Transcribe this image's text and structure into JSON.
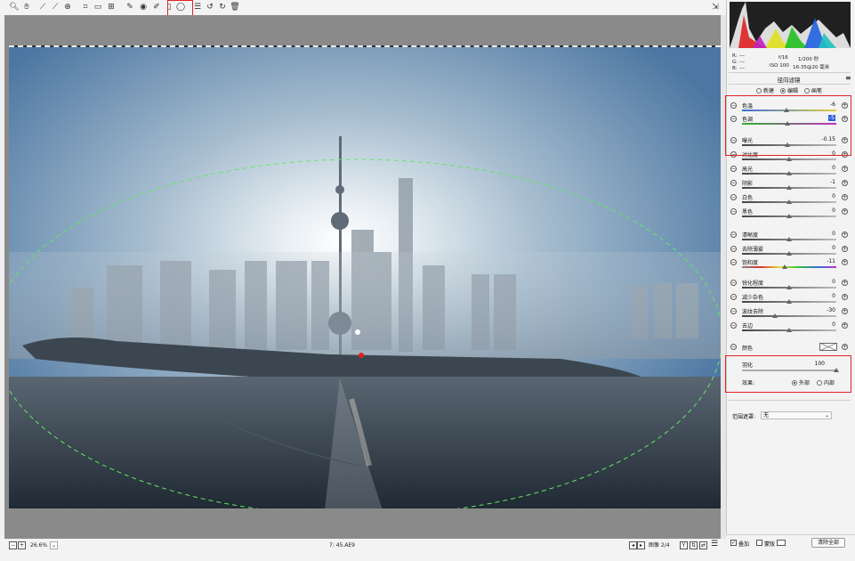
{
  "toolbar": {
    "icons": [
      "zoom-icon",
      "hand-icon",
      "white-balance-icon",
      "color-sampler-icon",
      "target-adjust-icon",
      "crop-icon",
      "straighten-icon",
      "transform-icon",
      "spot-removal-icon",
      "red-eye-icon",
      "adjustment-brush-icon",
      "graduated-filter-icon",
      "radial-filter-icon",
      "preferences-icon",
      "rotate-left-icon",
      "rotate-right-icon",
      "trash-icon"
    ],
    "fullscreen_icon": "fullscreen-icon"
  },
  "info": {
    "r_label": "R:",
    "g_label": "G:",
    "b_label": "B:",
    "r_val": "---",
    "g_val": "---",
    "b_val": "---",
    "aperture": "f/16",
    "shutter": "1/200 秒",
    "iso": "ISO 100",
    "lens": "16-35@20 毫米"
  },
  "panel": {
    "title": "径向滤镜",
    "modes": [
      {
        "label": "新建",
        "selected": false
      },
      {
        "label": "编辑",
        "selected": true
      },
      {
        "label": "画笔",
        "selected": false
      }
    ],
    "sliders": [
      {
        "label": "色温",
        "value": "-6",
        "pos": 0.47,
        "track": "temp"
      },
      {
        "label": "色调",
        "value": "-5",
        "pos": 0.48,
        "track": "tint",
        "selected": true
      },
      {
        "label": "曝光",
        "value": "-0.15",
        "pos": 0.48,
        "track": "plain"
      },
      {
        "label": "对比度",
        "value": "0",
        "pos": 0.5,
        "track": "plain"
      },
      {
        "label": "高光",
        "value": "0",
        "pos": 0.5,
        "track": "plain"
      },
      {
        "label": "阴影",
        "value": "-1",
        "pos": 0.5,
        "track": "plain"
      },
      {
        "label": "白色",
        "value": "0",
        "pos": 0.5,
        "track": "plain"
      },
      {
        "label": "黑色",
        "value": "0",
        "pos": 0.5,
        "track": "plain"
      },
      {
        "label": "清晰度",
        "value": "0",
        "pos": 0.5,
        "track": "plain"
      },
      {
        "label": "去除薄雾",
        "value": "0",
        "pos": 0.5,
        "track": "plain"
      },
      {
        "label": "饱和度",
        "value": "-11",
        "pos": 0.45,
        "track": "sat"
      },
      {
        "label": "锐化程度",
        "value": "0",
        "pos": 0.5,
        "track": "plain"
      },
      {
        "label": "减少杂色",
        "value": "0",
        "pos": 0.5,
        "track": "plain"
      },
      {
        "label": "波纹去除",
        "value": "-30",
        "pos": 0.35,
        "track": "plain"
      },
      {
        "label": "去边",
        "value": "0",
        "pos": 0.5,
        "track": "plain"
      }
    ],
    "color_label": "颜色",
    "feather_label": "羽化",
    "feather_value": "100",
    "feather_pos": 1.0,
    "effect_label": "效果:",
    "effect_options": [
      {
        "label": "外部",
        "selected": true
      },
      {
        "label": "内部",
        "selected": false
      }
    ],
    "range_mask_label": "范围遮罩:",
    "range_mask_value": "无",
    "overlay_label": "叠加",
    "mask_label": "蒙版",
    "clear_all_label": "清除全部"
  },
  "status": {
    "zoom": "26.6%",
    "coords": "7: 45.AE9",
    "image_counter": "图像 2/4",
    "btn_y": "Y"
  },
  "colors": {
    "highlight": "#e02424",
    "selection": "#2b5fd9",
    "mask_ellipse": "#64e664",
    "pin_red": "#e02020"
  }
}
